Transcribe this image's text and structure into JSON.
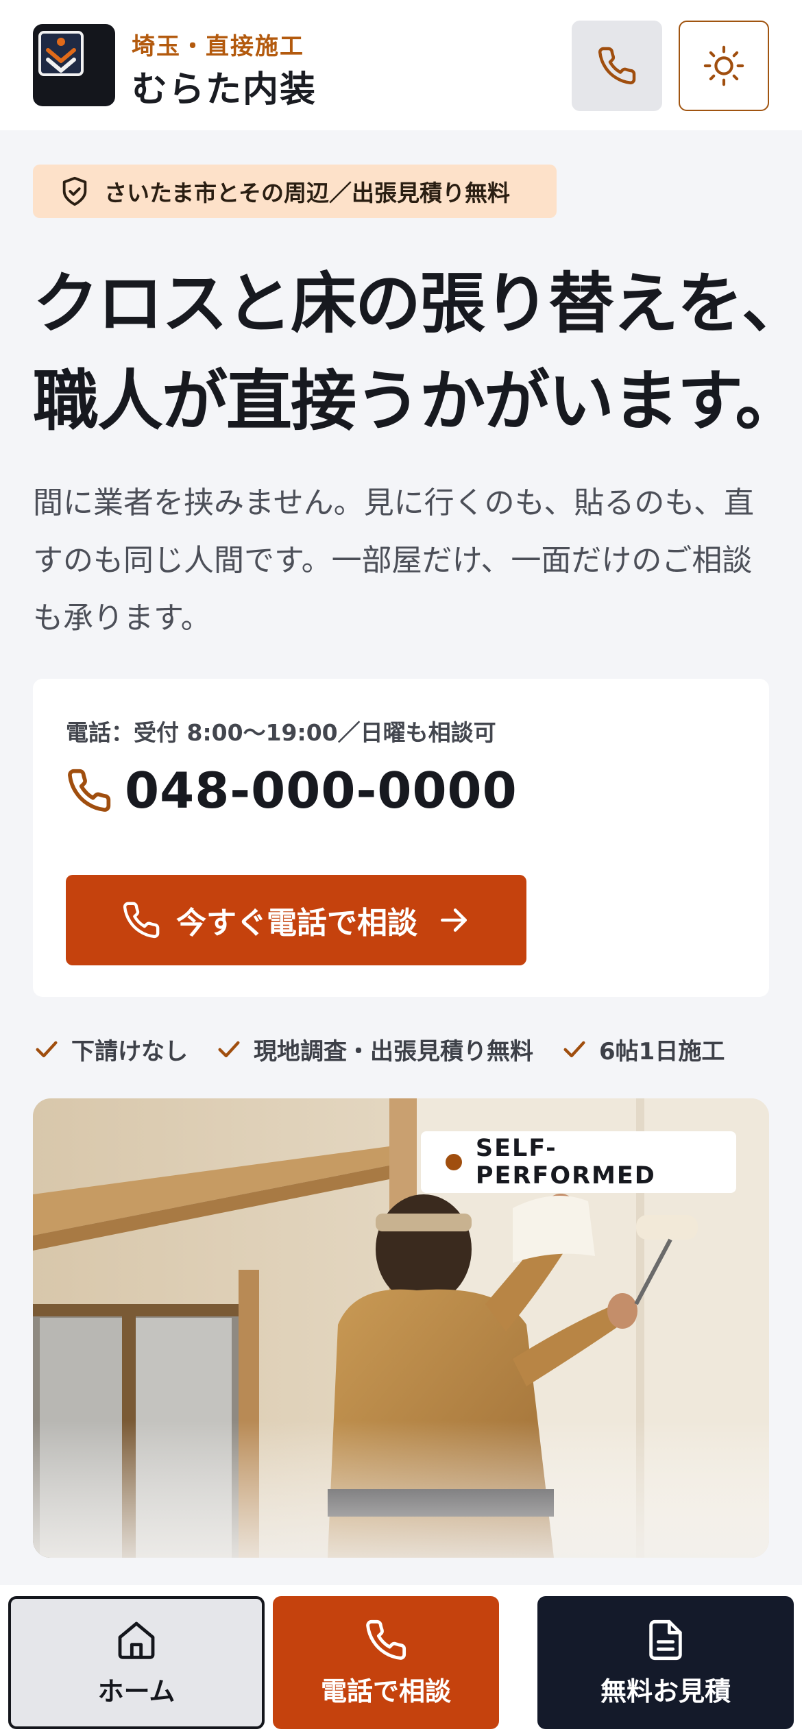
{
  "header": {
    "brand_region": "埼玉・直接施工",
    "brand_name": "むらた内装",
    "logo_icon": "chevron-badge-icon",
    "call_icon": "phone-icon",
    "theme_icon": "sun-icon"
  },
  "hero": {
    "area_badge": "さいたま市とその周辺／出張見積り無料",
    "area_badge_icon": "shield-check-icon",
    "headline_line1": "クロスと床の張り替えを、",
    "headline_line2": "職人が直接うかがいます。",
    "lead": "間に業者を挟みません。見に行くのも、貼るのも、直すのも同じ人間です。一部屋だけ、一面だけのご相談も承ります。"
  },
  "contact": {
    "hours": "電話：受付 8:00〜19:00／日曜も相談可",
    "phone_number": "048-000-0000",
    "cta_label": "今すぐ電話で相談"
  },
  "features": [
    {
      "label": "下請けなし"
    },
    {
      "label": "現地調査・出張見積り無料"
    },
    {
      "label": "6帖1日施工"
    }
  ],
  "photo": {
    "badge": "SELF-PERFORMED"
  },
  "bottom_nav": {
    "home": "ホーム",
    "call": "電話で相談",
    "quote": "無料お見積"
  },
  "colors": {
    "accent": "#c5420d",
    "brand_orange": "#b35a0e",
    "badge_bg": "#fde1c9",
    "navy": "#141a2a"
  }
}
